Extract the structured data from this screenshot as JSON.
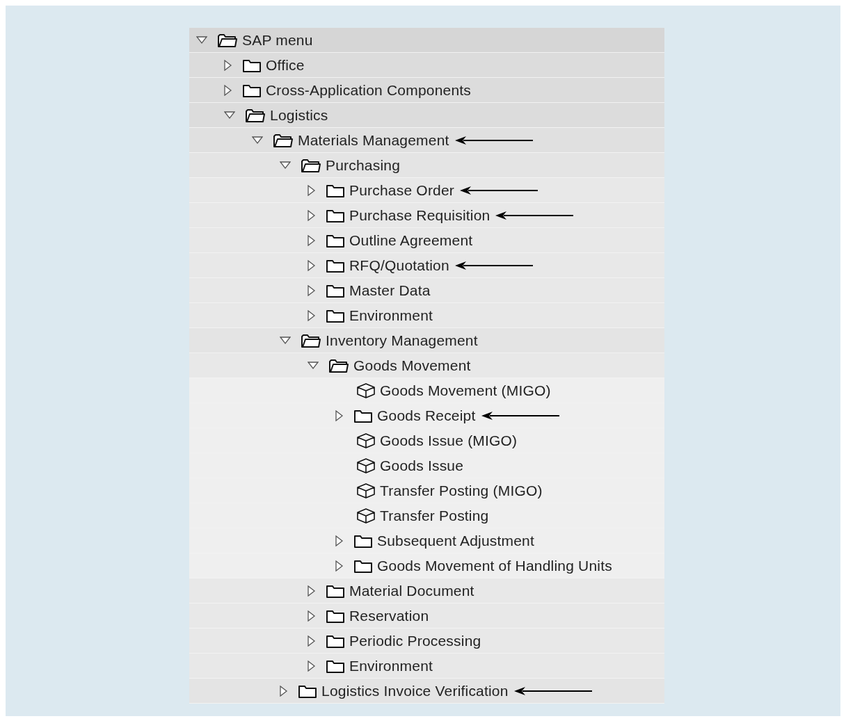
{
  "tree": [
    {
      "label": "SAP menu",
      "kind": "folder",
      "expanded": true,
      "marked": false,
      "children": [
        {
          "label": "Office",
          "kind": "folder",
          "expanded": false,
          "marked": false
        },
        {
          "label": "Cross-Application Components",
          "kind": "folder",
          "expanded": false,
          "marked": false
        },
        {
          "label": "Logistics",
          "kind": "folder",
          "expanded": true,
          "marked": false,
          "children": [
            {
              "label": "Materials Management",
              "kind": "folder",
              "expanded": true,
              "marked": true,
              "children": [
                {
                  "label": "Purchasing",
                  "kind": "folder",
                  "expanded": true,
                  "marked": false,
                  "children": [
                    {
                      "label": "Purchase Order",
                      "kind": "folder",
                      "expanded": false,
                      "marked": true
                    },
                    {
                      "label": "Purchase Requisition",
                      "kind": "folder",
                      "expanded": false,
                      "marked": true
                    },
                    {
                      "label": "Outline Agreement",
                      "kind": "folder",
                      "expanded": false,
                      "marked": false
                    },
                    {
                      "label": "RFQ/Quotation",
                      "kind": "folder",
                      "expanded": false,
                      "marked": true
                    },
                    {
                      "label": "Master Data",
                      "kind": "folder",
                      "expanded": false,
                      "marked": false
                    },
                    {
                      "label": "Environment",
                      "kind": "folder",
                      "expanded": false,
                      "marked": false
                    }
                  ]
                },
                {
                  "label": "Inventory Management",
                  "kind": "folder",
                  "expanded": true,
                  "marked": false,
                  "children": [
                    {
                      "label": "Goods Movement",
                      "kind": "folder",
                      "expanded": true,
                      "marked": false,
                      "children": [
                        {
                          "label": "Goods Movement (MIGO)",
                          "kind": "transaction",
                          "marked": false
                        },
                        {
                          "label": "Goods Receipt",
                          "kind": "folder",
                          "expanded": false,
                          "marked": true
                        },
                        {
                          "label": "Goods Issue (MIGO)",
                          "kind": "transaction",
                          "marked": false
                        },
                        {
                          "label": "Goods Issue",
                          "kind": "transaction",
                          "marked": false
                        },
                        {
                          "label": "Transfer Posting (MIGO)",
                          "kind": "transaction",
                          "marked": false
                        },
                        {
                          "label": "Transfer Posting",
                          "kind": "transaction",
                          "marked": false
                        },
                        {
                          "label": "Subsequent Adjustment",
                          "kind": "folder",
                          "expanded": false,
                          "marked": false
                        },
                        {
                          "label": "Goods Movement of Handling Units",
                          "kind": "folder",
                          "expanded": false,
                          "marked": false
                        }
                      ]
                    },
                    {
                      "label": "Material Document",
                      "kind": "folder",
                      "expanded": false,
                      "marked": false
                    },
                    {
                      "label": "Reservation",
                      "kind": "folder",
                      "expanded": false,
                      "marked": false
                    },
                    {
                      "label": "Periodic Processing",
                      "kind": "folder",
                      "expanded": false,
                      "marked": false
                    },
                    {
                      "label": "Environment",
                      "kind": "folder",
                      "expanded": false,
                      "marked": false
                    }
                  ]
                },
                {
                  "label": "Logistics Invoice Verification",
                  "kind": "folder",
                  "expanded": false,
                  "marked": true
                }
              ]
            }
          ]
        }
      ]
    }
  ]
}
